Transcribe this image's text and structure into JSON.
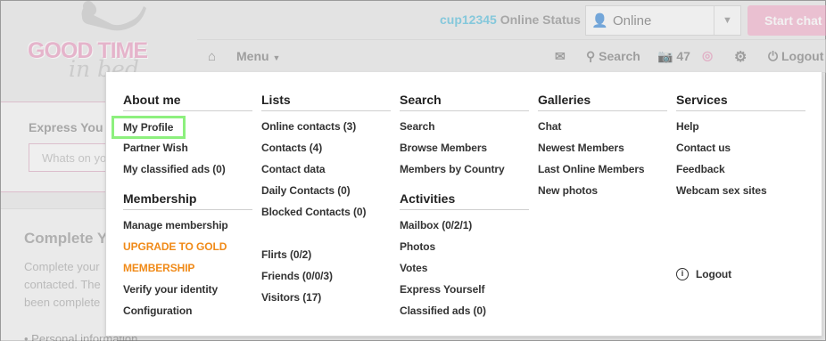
{
  "brand": {
    "logo_main": "GOOD TIME",
    "logo_sub": "in bed"
  },
  "topbar": {
    "username": "cup12345",
    "online_status_label": "Online Status",
    "status_value": "Online",
    "start_chat": "Start chat"
  },
  "nav": {
    "menu_label": "Menu",
    "search_label": "Search",
    "photo_count": "47",
    "logout_label": "Logout"
  },
  "left": {
    "express_title": "Express You",
    "express_placeholder": "Whats on yo",
    "complete_title": "Complete Y",
    "complete_text": "Complete your contacted. The been complete",
    "personal_info": "• Personal information"
  },
  "menu": {
    "about": {
      "heading": "About me",
      "items": [
        "My Profile",
        "Partner Wish",
        "My classified ads (0)"
      ]
    },
    "membership": {
      "heading": "Membership",
      "items": [
        "Manage membership",
        "UPGRADE TO GOLD",
        "MEMBERSHIP",
        "Verify your identity",
        "Configuration"
      ]
    },
    "lists": {
      "heading": "Lists",
      "items": [
        "Online contacts (3)",
        "Contacts (4)",
        "Contact data",
        "Daily Contacts (0)",
        "Blocked Contacts (0)",
        "Flirts (0/2)",
        "Friends (0/0/3)",
        "Visitors (17)"
      ]
    },
    "search": {
      "heading": "Search",
      "items": [
        "Search",
        "Browse Members",
        "Members by Country"
      ]
    },
    "activities": {
      "heading": "Activities",
      "items": [
        "Mailbox (0/2/1)",
        "Photos",
        "Votes",
        "Express Yourself",
        "Classified ads (0)"
      ]
    },
    "galleries": {
      "heading": "Galleries",
      "items": [
        "Chat",
        "Newest Members",
        "Last Online Members",
        "New photos"
      ]
    },
    "services": {
      "heading": "Services",
      "items": [
        "Help",
        "Contact us",
        "Feedback",
        "Webcam sex sites"
      ],
      "logout": "Logout"
    }
  },
  "colors": {
    "accent": "#f08a18",
    "highlight": "#8df07e",
    "brand_pink": "#e88fb8",
    "username": "#39b2d6"
  }
}
